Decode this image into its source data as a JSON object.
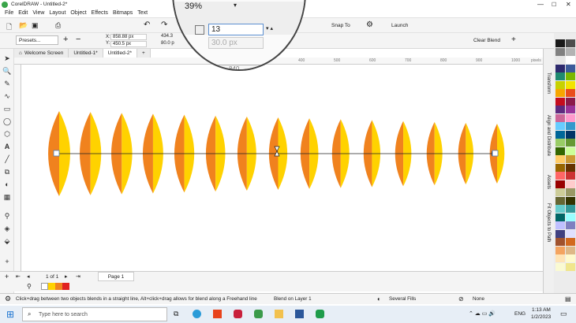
{
  "app": {
    "title": "CorelDRAW - Untitled-2*"
  },
  "menu": [
    "File",
    "Edit",
    "View",
    "Layout",
    "Object",
    "Effects",
    "Bitmaps",
    "Text"
  ],
  "toolbar": {
    "snap_to": "Snap To",
    "launch": "Launch",
    "clear_blend": "Clear Blend"
  },
  "property_bar": {
    "presets_placeholder": "Presets...",
    "x_value": "858.88 px",
    "y_value": "450.5 px",
    "width_value": "434.3",
    "height_value": "80.0 p",
    "x_label": "X:",
    "y_label": "Y:"
  },
  "magnifier": {
    "zoom_value": "39%",
    "steps_value": "13",
    "spacing_value": "30.0 px",
    "ruler_label": "840"
  },
  "tabs": [
    {
      "label": "Welcome Screen"
    },
    {
      "label": "Untitled-1*"
    },
    {
      "label": "Untitled-2*"
    }
  ],
  "ruler_ticks": [
    "400",
    "500",
    "600",
    "700",
    "800",
    "900",
    "1000",
    "1100",
    "1200",
    "1300",
    "1400",
    "1500",
    "1600"
  ],
  "ruler_unit": "pixels",
  "dockers": [
    "Transform",
    "Align and Distribute",
    "Assets",
    "Fit Objects to Path"
  ],
  "page_nav": {
    "counter": "1 of 1",
    "page_tab": "Page 1"
  },
  "statusbar": {
    "hint": "Click+drag between two objects blends in a straight line, Alt+click+drag allows for blend along a Freehand line",
    "layer": "Blend on Layer 1",
    "fill": "Several Fills",
    "outline": "None"
  },
  "taskbar": {
    "search_placeholder": "Type here to search",
    "language": "ENG",
    "time": "1:13 AM",
    "date": "1/2/2023"
  },
  "blend": {
    "count": 15,
    "color_dark": "#f0821e",
    "color_light": "#ffd200"
  },
  "palette_colors": [
    "#1a1a1a",
    "#4d4d4d",
    "#808080",
    "#b3b3b3",
    "#e6e6e6",
    "#ffffff",
    "#2e2a6e",
    "#3c5a9a",
    "#1f8a70",
    "#7ab800",
    "#c7d100",
    "#f2e400",
    "#f7a600",
    "#e94e1b",
    "#c40d1e",
    "#8b1a4a",
    "#5d2a7f",
    "#993399",
    "#cc6699",
    "#ff99cc",
    "#66ccff",
    "#3399cc",
    "#006699",
    "#003366",
    "#99cc66",
    "#669933",
    "#336600",
    "#ccff99",
    "#ffcc66",
    "#cc9933",
    "#996600",
    "#663300",
    "#ff6666",
    "#cc3333",
    "#990000",
    "#ffcccc",
    "#cccc99",
    "#999966",
    "#666633",
    "#333300",
    "#66cccc",
    "#339999",
    "#006666",
    "#99ffff",
    "#c0c0ff",
    "#8080c0",
    "#404080",
    "#e0e0ff",
    "#a0522d",
    "#d2691e",
    "#f4a460",
    "#deb887",
    "#ffe4b5",
    "#fffacd",
    "#fafad2",
    "#f0e68c"
  ]
}
